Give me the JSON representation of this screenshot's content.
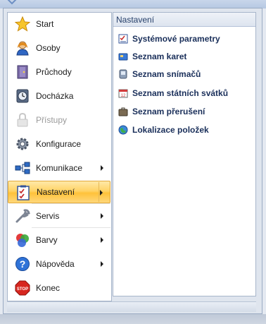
{
  "menu": {
    "items": [
      {
        "label": "Start",
        "icon": "star-icon",
        "enabled": true
      },
      {
        "label": "Osoby",
        "icon": "person-icon",
        "enabled": true
      },
      {
        "label": "Průchody",
        "icon": "door-icon",
        "enabled": true
      },
      {
        "label": "Docházka",
        "icon": "clock-icon",
        "enabled": true
      },
      {
        "label": "Přístupy",
        "icon": "lock-icon",
        "enabled": false
      },
      {
        "label": "Konfigurace",
        "icon": "gear-icon",
        "enabled": true
      },
      {
        "label": "Komunikace",
        "icon": "network-icon",
        "enabled": true,
        "submenu": true
      },
      {
        "label": "Nastavení",
        "icon": "checklist-icon",
        "enabled": true,
        "submenu": true,
        "selected": true
      },
      {
        "label": "Servis",
        "icon": "wrench-icon",
        "enabled": true,
        "submenu": true
      },
      {
        "label": "Barvy",
        "icon": "palette-icon",
        "enabled": true,
        "submenu": true
      },
      {
        "label": "Nápověda",
        "icon": "help-icon",
        "enabled": true,
        "submenu": true
      },
      {
        "label": "Konec",
        "icon": "stop-icon",
        "enabled": true
      }
    ]
  },
  "submenu": {
    "header": "Nastavení",
    "items": [
      {
        "label": "Systémové parametry",
        "icon": "settings-check-icon"
      },
      {
        "label": "Seznam karet",
        "icon": "cards-icon"
      },
      {
        "label": "Seznam snímačů",
        "icon": "reader-icon"
      },
      {
        "label": "Seznam státních svátků",
        "icon": "calendar-icon"
      },
      {
        "label": "Seznam přerušení",
        "icon": "briefcase-icon"
      },
      {
        "label": "Lokalizace položek",
        "icon": "globe-icon"
      }
    ]
  },
  "colors": {
    "selected_highlight": "#ffd366",
    "header_text": "#27406a",
    "item_text": "#1a2f5a"
  }
}
